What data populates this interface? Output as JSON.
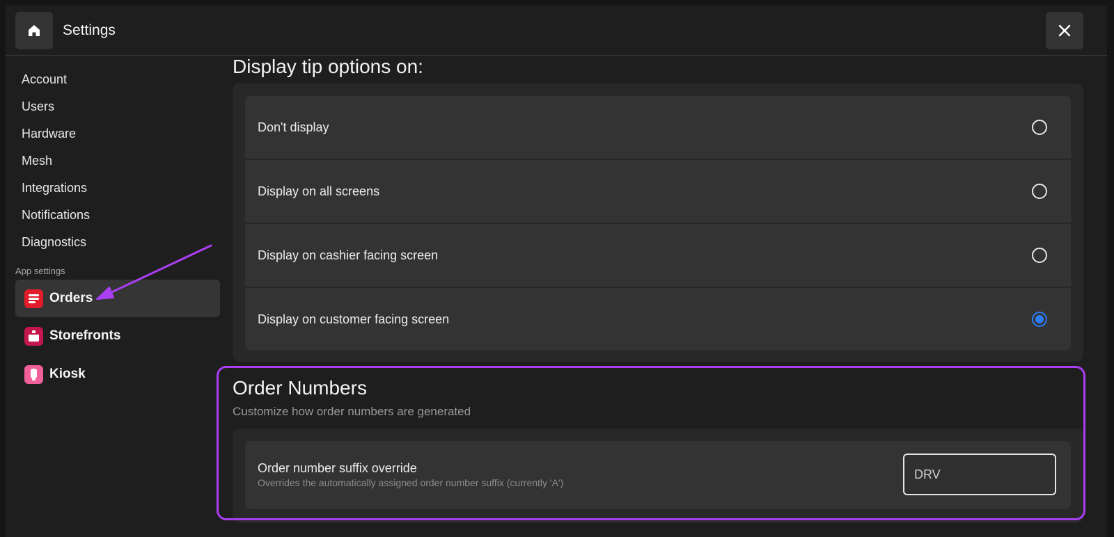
{
  "header": {
    "title": "Settings"
  },
  "sidebar": {
    "items": [
      {
        "label": "Account"
      },
      {
        "label": "Users"
      },
      {
        "label": "Hardware"
      },
      {
        "label": "Mesh"
      },
      {
        "label": "Integrations"
      },
      {
        "label": "Notifications"
      },
      {
        "label": "Diagnostics"
      }
    ],
    "section_label": "App settings",
    "apps": [
      {
        "label": "Orders",
        "icon": "orders-icon",
        "color": "#e21d2b",
        "active": true
      },
      {
        "label": "Storefronts",
        "icon": "storefronts-icon",
        "color": "#c3174e",
        "active": false
      },
      {
        "label": "Kiosk",
        "icon": "kiosk-icon",
        "color": "#f0609a",
        "active": false
      }
    ]
  },
  "tip_options": {
    "heading": "Display tip options on:",
    "options": [
      {
        "label": "Don't display",
        "selected": false
      },
      {
        "label": "Display on all screens",
        "selected": false
      },
      {
        "label": "Display on cashier facing screen",
        "selected": false
      },
      {
        "label": "Display on customer facing screen",
        "selected": true
      }
    ]
  },
  "order_numbers": {
    "title": "Order Numbers",
    "subtitle": "Customize how order numbers are generated",
    "suffix": {
      "label": "Order number suffix override",
      "description": "Overrides the automatically assigned order number suffix (currently 'A')",
      "value": "DRV"
    }
  },
  "colors": {
    "accent_blue": "#2b7cf6",
    "annotation_purple": "#a93ef2"
  }
}
